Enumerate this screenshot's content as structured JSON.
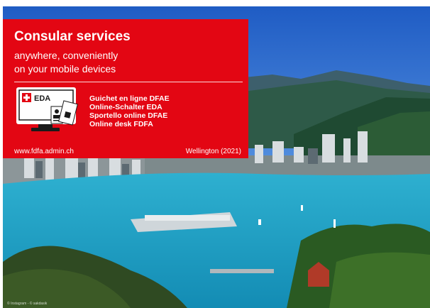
{
  "panel": {
    "title": "Consular services",
    "subtitle_line_1": "anywhere, conveniently",
    "subtitle_line_2": "on your mobile devices",
    "icon_label": "EDA",
    "desk_names": [
      "Guichet en ligne DFAE",
      "Online-Schalter EDA",
      "Sportello online DFAE",
      "Online desk FDFA"
    ],
    "url": "www.fdfa.admin.ch",
    "location": "Wellington (2021)"
  },
  "photo_credit": "© Instagram - © sakdasik",
  "colors": {
    "panel_red": "#e30613",
    "text_white": "#ffffff",
    "harbour_blue": "#1fa3c4",
    "sky_blue": "#3d7fd8"
  },
  "icons": [
    "swiss-cross-icon",
    "computer-monitor-icon",
    "id-card-icon",
    "passport-icon"
  ]
}
